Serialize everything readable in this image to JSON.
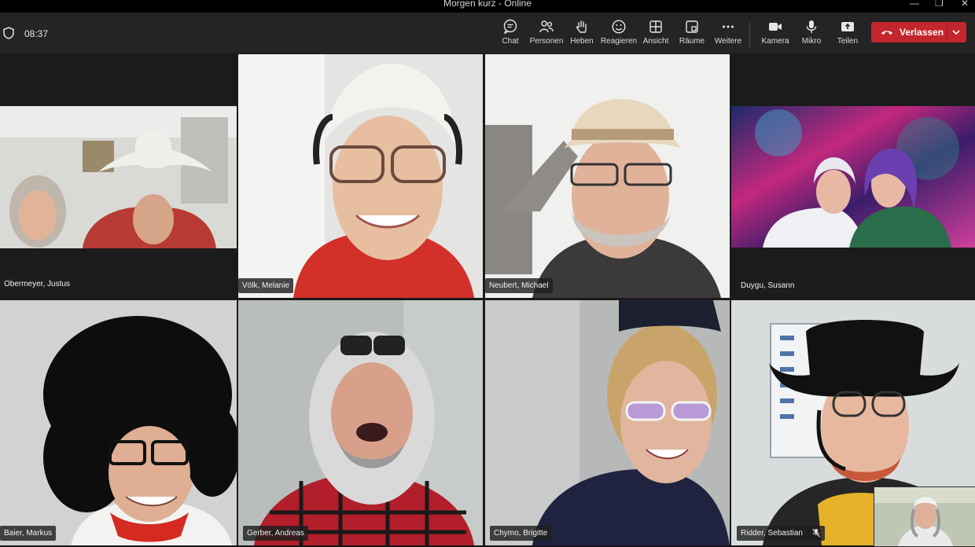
{
  "window": {
    "title": "Morgen kurz - Online"
  },
  "meeting": {
    "elapsed": "08:37"
  },
  "toolbar": {
    "chat": "Chat",
    "people": "Personen",
    "raise": "Heben",
    "react": "Reagieren",
    "view": "Ansicht",
    "rooms": "Räume",
    "more": "Weitere",
    "camera": "Kamera",
    "mic": "Mikro",
    "share": "Teilen",
    "leave": "Verlassen"
  },
  "colors": {
    "leave": "#c4262e",
    "selected_outline": "#6264a7",
    "toolbar_bg": "#242424"
  },
  "participants": [
    {
      "name": "Obermeyer, Justus"
    },
    {
      "name": "Völk, Melanie"
    },
    {
      "name": "Neubert, Michael"
    },
    {
      "name": "Duygu, Susann"
    },
    {
      "name": "Baier, Markus"
    },
    {
      "name": "Gerber, Andreas"
    },
    {
      "name": "Chymo, Brigitte"
    },
    {
      "name": "Ridder, Sebastian"
    }
  ]
}
